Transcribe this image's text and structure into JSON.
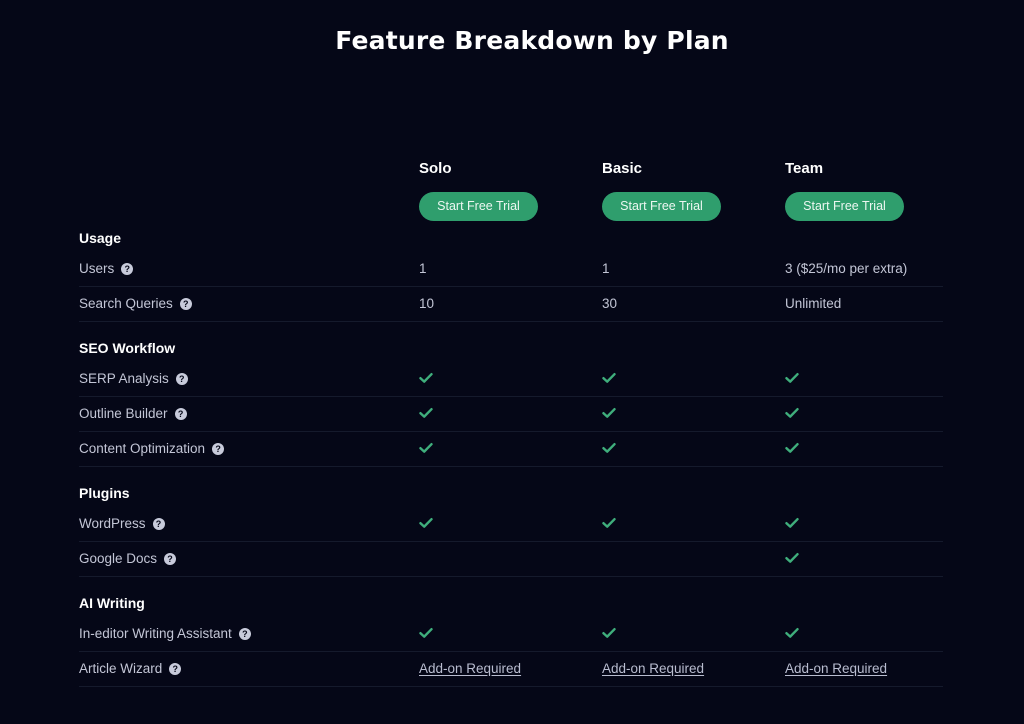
{
  "page": {
    "title": "Feature Breakdown by Plan"
  },
  "colors": {
    "background": "#050717",
    "accent_green": "#2f9e6d",
    "check_green": "#3fae7c",
    "text_primary": "#ffffff",
    "text_secondary": "#c3c6d6"
  },
  "plans": [
    {
      "name": "Solo",
      "cta_label": "Start Free Trial"
    },
    {
      "name": "Basic",
      "cta_label": "Start Free Trial"
    },
    {
      "name": "Team",
      "cta_label": "Start Free Trial"
    }
  ],
  "icons": {
    "help": "question-circle-icon",
    "included": "check-icon"
  },
  "help_glyph": "?",
  "sections": [
    {
      "title": "Usage",
      "rows": [
        {
          "label": "Users",
          "values": [
            {
              "type": "text",
              "text": "1"
            },
            {
              "type": "text",
              "text": "1"
            },
            {
              "type": "text",
              "text": "3 ($25/mo per extra)"
            }
          ]
        },
        {
          "label": "Search Queries",
          "values": [
            {
              "type": "text",
              "text": "10"
            },
            {
              "type": "text",
              "text": "30"
            },
            {
              "type": "text",
              "text": "Unlimited"
            }
          ]
        }
      ]
    },
    {
      "title": "SEO Workflow",
      "rows": [
        {
          "label": "SERP Analysis",
          "values": [
            {
              "type": "check"
            },
            {
              "type": "check"
            },
            {
              "type": "check"
            }
          ]
        },
        {
          "label": "Outline Builder",
          "values": [
            {
              "type": "check"
            },
            {
              "type": "check"
            },
            {
              "type": "check"
            }
          ]
        },
        {
          "label": "Content Optimization",
          "values": [
            {
              "type": "check"
            },
            {
              "type": "check"
            },
            {
              "type": "check"
            }
          ]
        }
      ]
    },
    {
      "title": "Plugins",
      "rows": [
        {
          "label": "WordPress",
          "values": [
            {
              "type": "check"
            },
            {
              "type": "check"
            },
            {
              "type": "check"
            }
          ]
        },
        {
          "label": "Google Docs",
          "values": [
            {
              "type": "empty"
            },
            {
              "type": "empty"
            },
            {
              "type": "check"
            }
          ]
        }
      ]
    },
    {
      "title": "AI Writing",
      "rows": [
        {
          "label": "In-editor Writing Assistant",
          "values": [
            {
              "type": "check"
            },
            {
              "type": "check"
            },
            {
              "type": "check"
            }
          ]
        },
        {
          "label": "Article Wizard",
          "values": [
            {
              "type": "link",
              "text": "Add-on Required"
            },
            {
              "type": "link",
              "text": "Add-on Required"
            },
            {
              "type": "link",
              "text": "Add-on Required"
            }
          ]
        }
      ]
    }
  ]
}
